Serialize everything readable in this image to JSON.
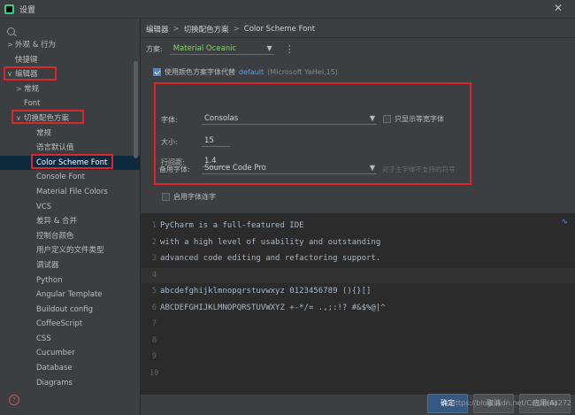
{
  "window": {
    "title": "设置"
  },
  "sidebar": {
    "items": [
      {
        "label": "外观 & 行为",
        "arrow": ">",
        "level": 0
      },
      {
        "label": "快捷键",
        "arrow": "",
        "level": 0
      },
      {
        "label": "编辑器",
        "arrow": "∨",
        "level": 0
      },
      {
        "label": "常规",
        "arrow": ">",
        "level": 1
      },
      {
        "label": "Font",
        "arrow": "",
        "level": 1
      },
      {
        "label": "切换配色方案",
        "arrow": "∨",
        "level": 1
      },
      {
        "label": "常规",
        "arrow": "",
        "level": 2
      },
      {
        "label": "语言默认值",
        "arrow": "",
        "level": 2
      },
      {
        "label": "Color Scheme Font",
        "arrow": "",
        "level": 2,
        "selected": true
      },
      {
        "label": "Console Font",
        "arrow": "",
        "level": 2
      },
      {
        "label": "Material File Colors",
        "arrow": "",
        "level": 2
      },
      {
        "label": "VCS",
        "arrow": "",
        "level": 2
      },
      {
        "label": "差异 & 合并",
        "arrow": "",
        "level": 2
      },
      {
        "label": "控制台颜色",
        "arrow": "",
        "level": 2
      },
      {
        "label": "用户定义的文件类型",
        "arrow": "",
        "level": 2
      },
      {
        "label": "调试器",
        "arrow": "",
        "level": 2
      },
      {
        "label": "Python",
        "arrow": "",
        "level": 2
      },
      {
        "label": "Angular Template",
        "arrow": "",
        "level": 2
      },
      {
        "label": "Buildout config",
        "arrow": "",
        "level": 2
      },
      {
        "label": "CoffeeScript",
        "arrow": "",
        "level": 2
      },
      {
        "label": "CSS",
        "arrow": "",
        "level": 2
      },
      {
        "label": "Cucumber",
        "arrow": "",
        "level": 2
      },
      {
        "label": "Database",
        "arrow": "",
        "level": 2
      },
      {
        "label": "Diagrams",
        "arrow": "",
        "level": 2
      }
    ]
  },
  "breadcrumb": {
    "part1": "编辑器",
    "sep": ">",
    "part2": "切换配色方案",
    "part3": "Color Scheme Font"
  },
  "scheme": {
    "label": "方案:",
    "value": "Material Oceanic",
    "menu_glyph": "⋮"
  },
  "use_default": {
    "label": "使用颜色方案字体代替",
    "link": "default",
    "detail": "(Microsoft YaHei,15)",
    "checked": true
  },
  "font": {
    "font_label": "字体:",
    "font_value": "Consolas",
    "mono_only_label": "只显示等宽字体",
    "size_label": "大小:",
    "size_value": "15",
    "spacing_label": "行间距:",
    "spacing_value": "1.4",
    "fallback_label": "备用字体:",
    "fallback_value": "Source Code Pro",
    "fallback_hint": "对于主字体不支持的符号"
  },
  "ligatures_label": "启用字体连字",
  "preview": {
    "lines": [
      {
        "num": "1",
        "text": "PyCharm is a full-featured IDE"
      },
      {
        "num": "2",
        "text": "with a high level of usability and outstanding"
      },
      {
        "num": "3",
        "text": "advanced code editing and refactoring support."
      },
      {
        "num": "4",
        "text": ""
      },
      {
        "num": "5",
        "text": "abcdefghijklmnopqrstuvwxyz 0123456789 (){}[]"
      },
      {
        "num": "6",
        "text": "ABCDEFGHIJKLMNOPQRSTUVWXYZ +-*/= .,;:!? #&$%@|^"
      },
      {
        "num": "7",
        "text": ""
      },
      {
        "num": "8",
        "text": ""
      },
      {
        "num": "9",
        "text": ""
      },
      {
        "num": "10",
        "text": ""
      }
    ]
  },
  "footer": {
    "ok": "确定",
    "cancel": "取消",
    "apply": "应用(A)"
  },
  "watermark": "https://blog.csdn.net/Cristiano272",
  "icons": {
    "arrow_right": "chevron-right-icon",
    "arrow_down": "chevron-down-icon",
    "search": "search-icon",
    "help": "help-icon"
  },
  "colors": {
    "accent": "#589df6",
    "scheme_value": "#8dcf73",
    "annotation_red": "#e0242b",
    "selected_row": "#0d293e"
  }
}
